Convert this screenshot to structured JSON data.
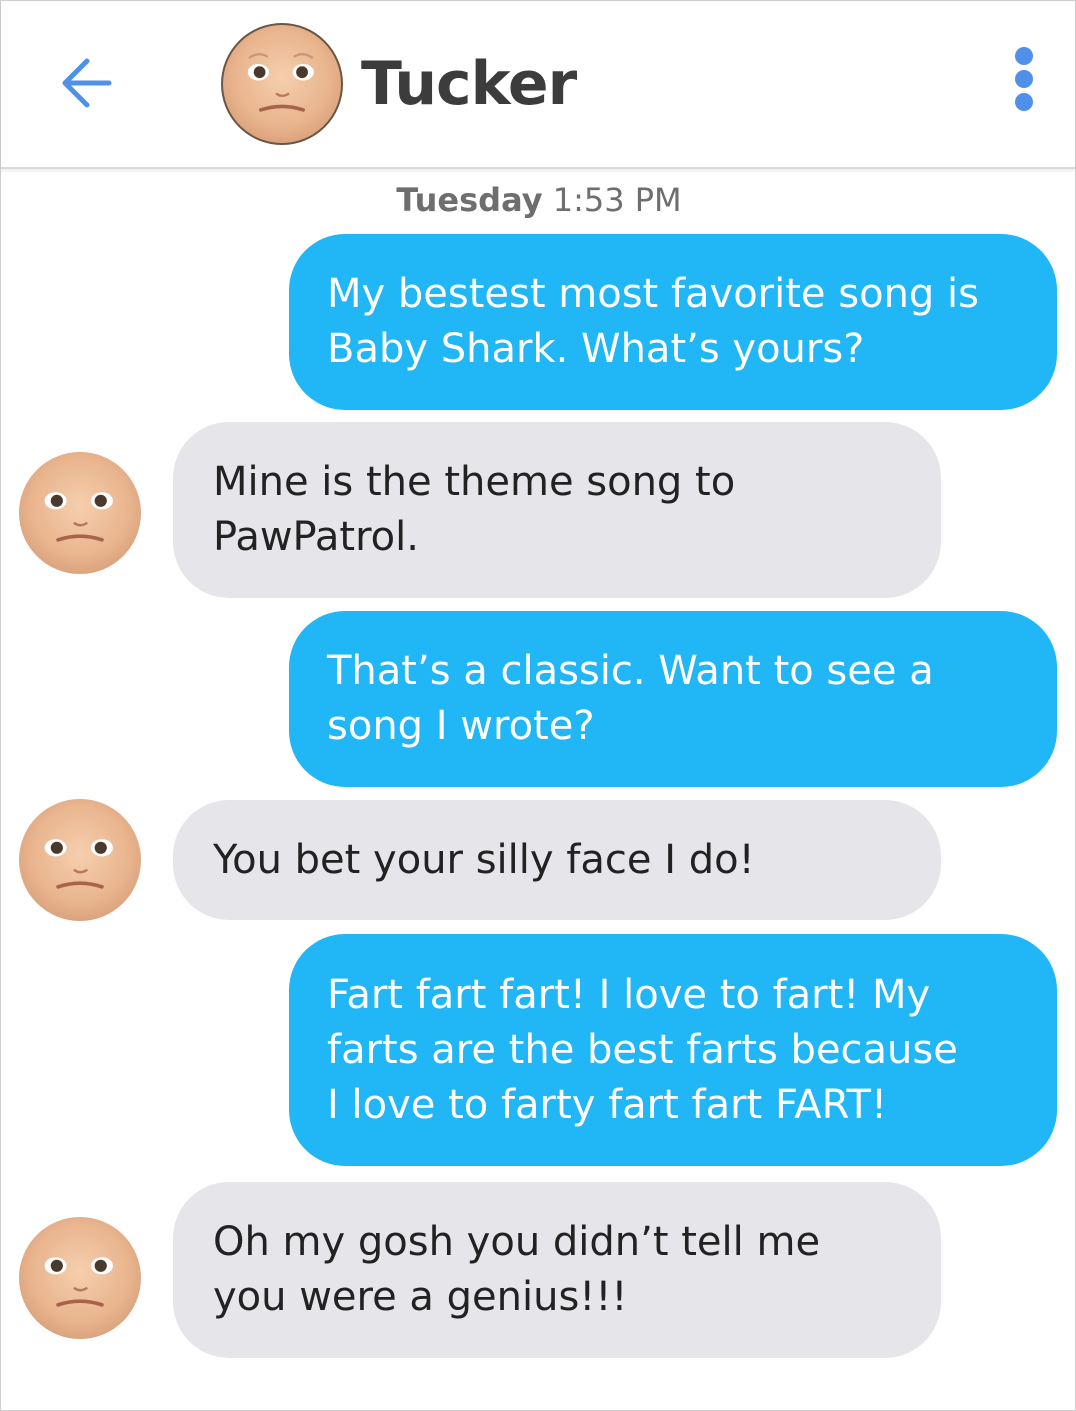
{
  "header": {
    "contact_name": "Tucker",
    "back_icon": "arrow-left-icon",
    "menu_icon": "more-vertical-icon",
    "accent": "#4f91e8"
  },
  "timestamp": {
    "day": "Tuesday",
    "time": "1:53 PM"
  },
  "colors": {
    "sent_bubble": "#21b6f5",
    "received_bubble": "#e6e6ea"
  },
  "messages": [
    {
      "direction": "sent",
      "text": "My bestest most favorite song is\nBaby Shark. What’s yours?"
    },
    {
      "direction": "received",
      "text": "Mine is the theme song to\nPawPatrol."
    },
    {
      "direction": "sent",
      "text": "That’s a classic. Want to see a\nsong I wrote?"
    },
    {
      "direction": "received",
      "text": "You bet your silly face I do!"
    },
    {
      "direction": "sent",
      "text": "Fart fart fart! I love to fart! My\nfarts are the best farts because\nI love to farty fart fart FART!"
    },
    {
      "direction": "received",
      "text": "Oh my gosh you didn’t tell me\nyou were a genius!!!"
    }
  ]
}
